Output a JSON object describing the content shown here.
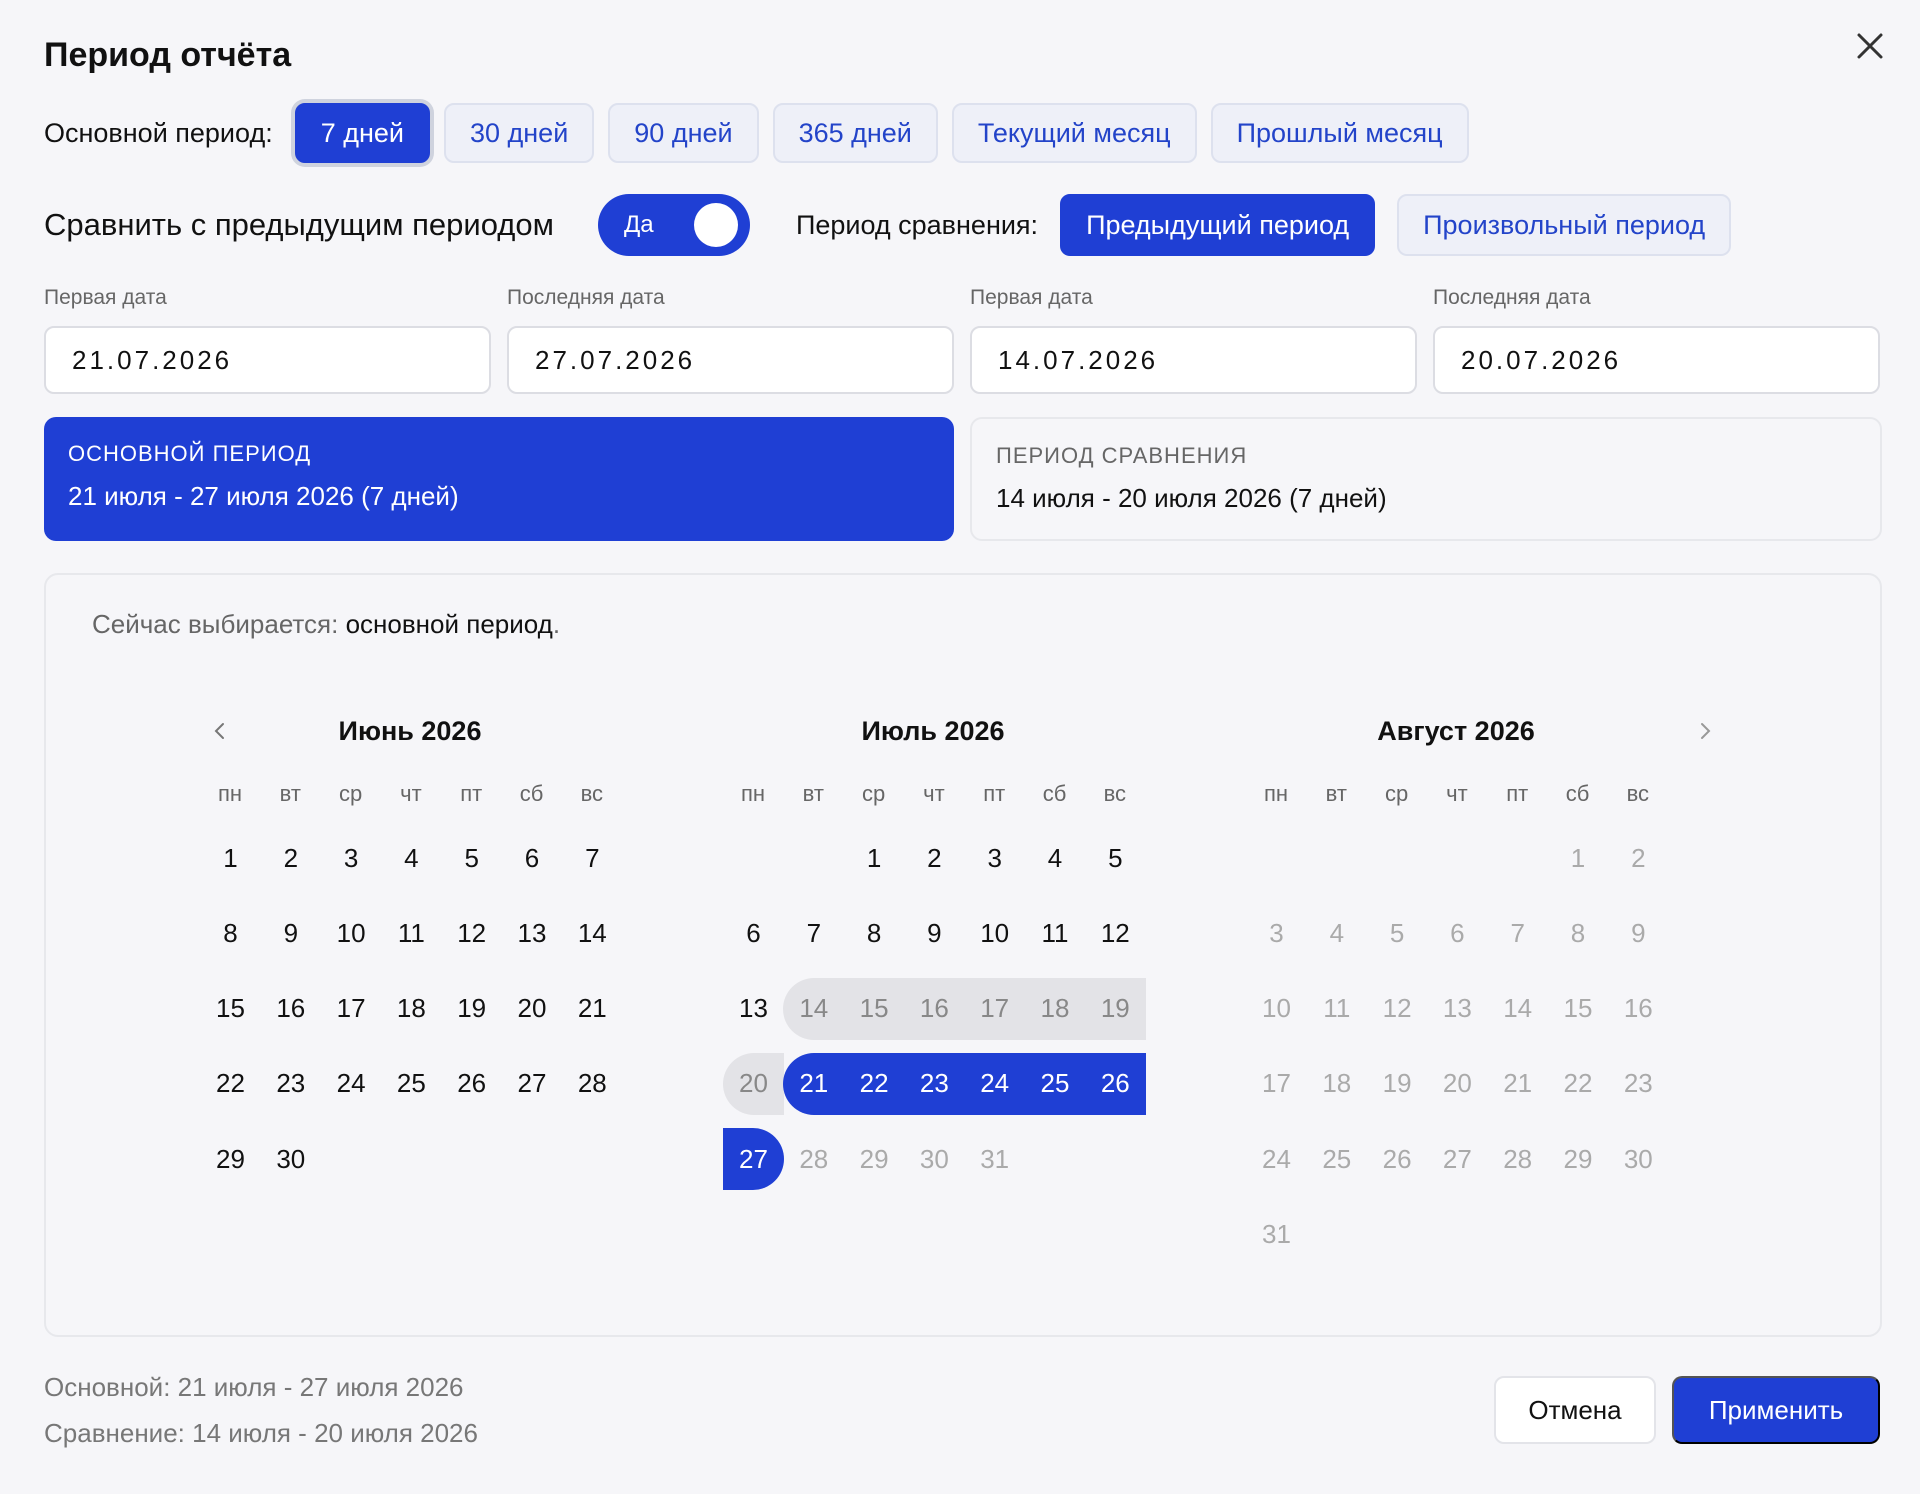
{
  "dialog": {
    "title": "Период отчёта"
  },
  "main_period": {
    "label": "Основной период:",
    "options": [
      "7 дней",
      "30 дней",
      "90 дней",
      "365 дней",
      "Текущий месяц",
      "Прошлый месяц"
    ],
    "selected": "7 дней"
  },
  "compare": {
    "label": "Сравнить с предыдущим периодом",
    "toggle_label": "Да",
    "toggle_on": true,
    "period_label": "Период сравнения:",
    "options": [
      "Предыдущий период",
      "Произвольный период"
    ],
    "selected": "Предыдущий период"
  },
  "fields": [
    {
      "label": "Первая дата",
      "value": "21.07.2026"
    },
    {
      "label": "Последняя дата",
      "value": "27.07.2026"
    },
    {
      "label": "Первая дата",
      "value": "14.07.2026"
    },
    {
      "label": "Последняя дата",
      "value": "20.07.2026"
    }
  ],
  "summary": {
    "main_caption": "ОСНОВНОЙ ПЕРИОД",
    "main_text": "21 июля - 27 июля 2026 (7 дней)",
    "cmp_caption": "ПЕРИОД СРАВНЕНИЯ",
    "cmp_text": "14 июля - 20 июля 2026 (7 дней)"
  },
  "calendar": {
    "selecting_prefix": "Сейчас выбирается:",
    "selecting_value": "основной период",
    "selecting_suffix": ".",
    "weekdays": [
      "пн",
      "вт",
      "ср",
      "чт",
      "пт",
      "сб",
      "вс"
    ],
    "months": [
      {
        "title": "Июнь 2026",
        "first_weekday": 0,
        "days": 30,
        "muted_after": null,
        "cmp_range": null,
        "sel_range": null
      },
      {
        "title": "Июль 2026",
        "first_weekday": 2,
        "days": 31,
        "muted_after": 27,
        "cmp_range": [
          14,
          20
        ],
        "sel_range": [
          21,
          27
        ]
      },
      {
        "title": "Август 2026",
        "first_weekday": 5,
        "days": 31,
        "muted_after": 0,
        "cmp_range": null,
        "sel_range": null
      }
    ],
    "prev_icon": "chevron-left-icon",
    "next_icon": "chevron-right-icon"
  },
  "footer": {
    "main_line": "Основной: 21 июля - 27 июля 2026",
    "cmp_line": "Сравнение: 14 июля - 20 июля 2026",
    "cancel_label": "Отмена",
    "apply_label": "Применить"
  },
  "colors": {
    "accent": "#1f3fd4",
    "compare_bg": "#e3e3e7",
    "muted": "#aaaaaa"
  }
}
